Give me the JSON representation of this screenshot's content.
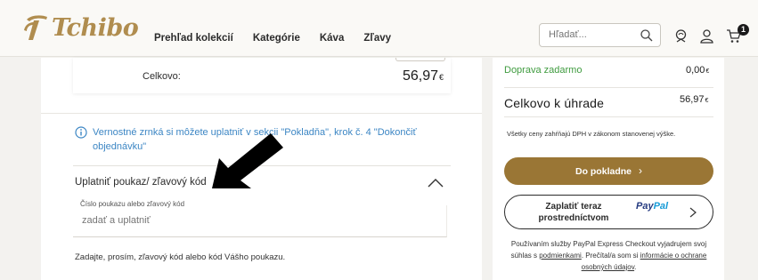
{
  "header": {
    "logo_text": "Tchibo",
    "nav": [
      "Prehľad kolekcií",
      "Kategórie",
      "Káva",
      "Zľavy"
    ],
    "search_placeholder": "Hľadať...",
    "cart_count": "1"
  },
  "order": {
    "total_label": "Celkovo:",
    "total_value": "56,97",
    "currency": "€"
  },
  "loyalty_info": "Vernostné zrnká si môžete uplatniť v sekcii \"Pokladňa\", krok č. 4 \"Dokončiť objednávku\"",
  "voucher": {
    "title": "Uplatniť poukaz/ zľavový kód",
    "field_label": "Číslo poukazu alebo zľavový kód",
    "input_placeholder": "zadať a uplatniť",
    "help_text": "Zadajte, prosím, zľavový kód alebo kód Vášho poukazu."
  },
  "summary": {
    "shipping_label": "Doprava zadarmo",
    "shipping_value": "0,00",
    "grand_label": "Celkovo k úhrade",
    "grand_value": "56,97",
    "currency": "€",
    "vat_note": "Všetky ceny zahŕňajú DPH v zákonom stanovenej výške.",
    "checkout_label": "Do pokladne",
    "paypal_label": "Zaplatiť teraz prostredníctvom",
    "paypal_logo_pay": "Pay",
    "paypal_logo_pal": "Pal",
    "paypal_note_1": "Používaním služby PayPal Express Checkout vyjadrujem svoj súhlas s ",
    "paypal_note_link1": "podmienkami",
    "paypal_note_2": ". Prečítal/a som si ",
    "paypal_note_link2": "informácie o ochrane osobných údajov",
    "paypal_note_3": "."
  },
  "colors": {
    "brand_gold": "#b08d4f",
    "checkout_button": "#9a7635",
    "info_blue": "#3c86c4",
    "shipping_green": "#3f9b3f"
  }
}
